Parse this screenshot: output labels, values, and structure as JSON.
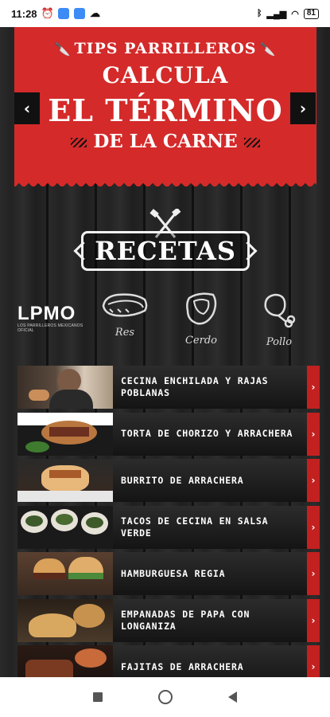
{
  "status_bar": {
    "time": "11:28",
    "battery": "81",
    "icons_left": [
      "alarm-icon",
      "app-icon",
      "app-icon",
      "cloud-icon"
    ],
    "icons_right": [
      "bluetooth-icon",
      "signal-icon",
      "wifi-icon",
      "battery-icon"
    ]
  },
  "banner": {
    "tag": "TIPS PARRILLEROS",
    "line1": "CALCULA",
    "line2": "EL TÉRMINO",
    "line3": "DE LA CARNE",
    "color": "#d42a2a"
  },
  "recetas": {
    "label": "RECETAS"
  },
  "logo": {
    "text": "LPMO",
    "sub": "LOS PARRILLEROS MEXICANOS OFICIAL"
  },
  "categories": [
    {
      "label": "Res",
      "icon": "steak-icon"
    },
    {
      "label": "Cerdo",
      "icon": "pork-chop-icon"
    },
    {
      "label": "Pollo",
      "icon": "chicken-leg-icon"
    }
  ],
  "recipes": [
    {
      "title": "CECINA ENCHILADA Y RAJAS POBLANAS"
    },
    {
      "title": "TORTA DE CHORIZO Y ARRACHERA"
    },
    {
      "title": "BURRITO DE ARRACHERA"
    },
    {
      "title": "TACOS DE CECINA EN SALSA VERDE"
    },
    {
      "title": "HAMBURGUESA REGIA"
    },
    {
      "title": "EMPANADAS DE PAPA CON LONGANIZA"
    },
    {
      "title": "FAJITAS DE ARRACHERA"
    }
  ]
}
